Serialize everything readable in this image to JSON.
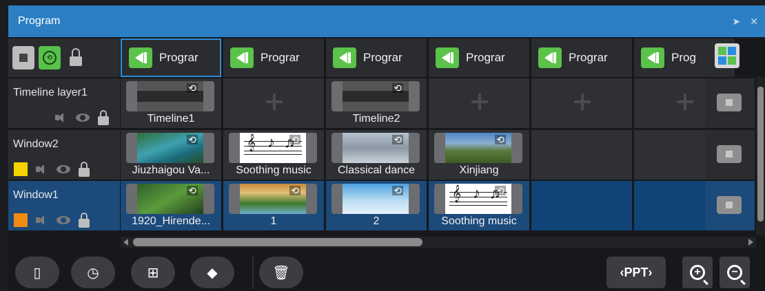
{
  "window": {
    "title": "Program",
    "pin_icon": "pin-icon",
    "close_icon": "close-icon"
  },
  "controls": {
    "stop_icon": "stop-icon",
    "loop_icon": "loop-play-icon",
    "lock_icon": "unlock-icon"
  },
  "programs": [
    {
      "label": "Prograr",
      "active": true
    },
    {
      "label": "Prograr",
      "active": false
    },
    {
      "label": "Prograr",
      "active": false
    },
    {
      "label": "Prograr",
      "active": false
    },
    {
      "label": "Prograr",
      "active": false
    },
    {
      "label": "Prog",
      "active": false
    }
  ],
  "layers": [
    {
      "name": "Timeline layer1",
      "color": null,
      "cells": [
        {
          "type": "timeline",
          "caption": "Timeline1"
        },
        {
          "type": "add"
        },
        {
          "type": "timeline",
          "caption": "Timeline2"
        },
        {
          "type": "add"
        },
        {
          "type": "add"
        },
        {
          "type": "add"
        }
      ]
    },
    {
      "name": "Window2",
      "color": "#f4d400",
      "cells": [
        {
          "type": "media",
          "caption": "Jiuzhaigou Va...",
          "thumb": "lake"
        },
        {
          "type": "audio",
          "caption": "Soothing music"
        },
        {
          "type": "media",
          "caption": "Classical dance",
          "thumb": "dance"
        },
        {
          "type": "media",
          "caption": "Xinjiang",
          "thumb": "xinj"
        },
        {
          "type": "empty"
        },
        {
          "type": "empty"
        }
      ]
    },
    {
      "name": "Window1",
      "color": "#f08a12",
      "selected": true,
      "cells": [
        {
          "type": "media",
          "caption": "1920_Hirende...",
          "thumb": "hiren"
        },
        {
          "type": "media",
          "caption": "1",
          "thumb": "fall"
        },
        {
          "type": "media",
          "caption": "2",
          "thumb": "sky"
        },
        {
          "type": "audio",
          "caption": "Soothing music"
        },
        {
          "type": "empty"
        },
        {
          "type": "empty"
        }
      ]
    }
  ],
  "toolbar": {
    "buttons": [
      "film-icon",
      "clock-icon",
      "add-window-icon",
      "tag-icon",
      "trash-icon"
    ],
    "ppt_label": "‹PPT›",
    "zoom_in": "zoom-in-icon",
    "zoom_out": "zoom-out-icon"
  }
}
